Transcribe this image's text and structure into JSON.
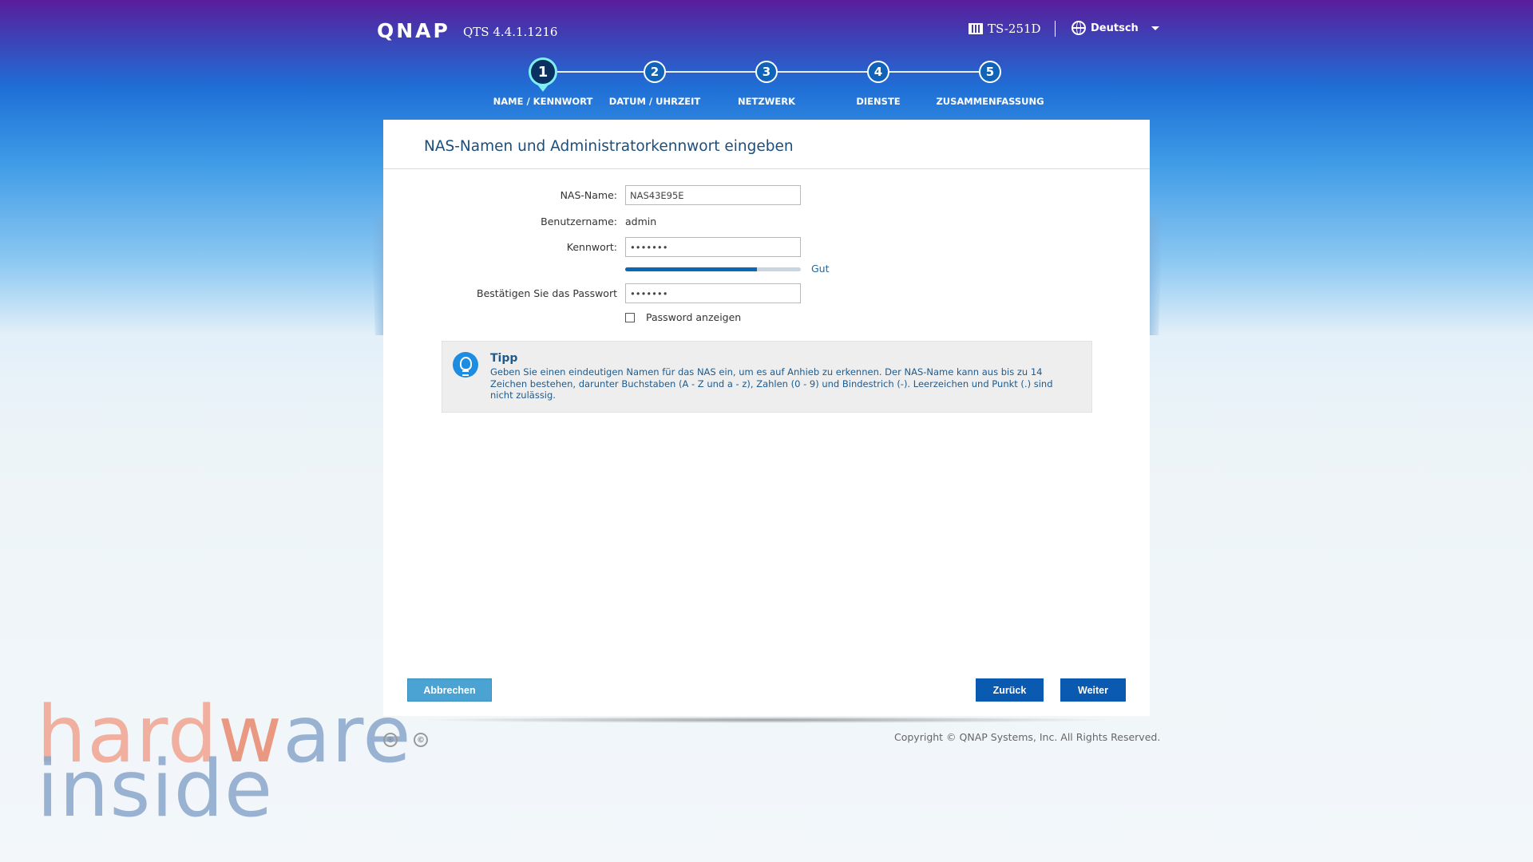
{
  "header": {
    "logo": "QNAP",
    "version": "QTS 4.4.1.1216",
    "device": "TS-251D",
    "language": "Deutsch"
  },
  "steps": [
    {
      "number": "1",
      "label": "NAME / KENNWORT",
      "active": true
    },
    {
      "number": "2",
      "label": "DATUM / UHRZEIT",
      "active": false
    },
    {
      "number": "3",
      "label": "NETZWERK",
      "active": false
    },
    {
      "number": "4",
      "label": "DIENSTE",
      "active": false
    },
    {
      "number": "5",
      "label": "ZUSAMMENFASSUNG",
      "active": false
    }
  ],
  "panel": {
    "title": "NAS-Namen und Administratorkennwort eingeben"
  },
  "form": {
    "nas_name_label": "NAS-Name:",
    "nas_name_value": "NAS43E95E",
    "username_label": "Benutzername:",
    "username_value": "admin",
    "password_label": "Kennwort:",
    "password_value": "•••••••",
    "strength_percent": 75,
    "strength_label": "Gut",
    "confirm_label": "Bestätigen Sie das Passwort",
    "confirm_value": "•••••••",
    "show_password_label": "Password anzeigen",
    "show_password_checked": false
  },
  "tip": {
    "title": "Tipp",
    "text": "Geben Sie einen eindeutigen Namen für das NAS ein, um es auf Anhieb zu erkennen. Der NAS-Name kann aus bis zu 14 Zeichen bestehen, darunter Buchstaben (A - Z und a - z), Zahlen (0 - 9) und Bindestrich (-). Leerzeichen und Punkt (.) sind nicht zulässig."
  },
  "buttons": {
    "cancel": "Abbrechen",
    "back": "Zurück",
    "next": "Weiter"
  },
  "footer": {
    "copyright": "Copyright © QNAP Systems, Inc. All Rights Reserved."
  },
  "watermark": {
    "line1_a": "hard",
    "line1_b": "w",
    "line1_c": "are",
    "line2": "inside",
    "badge1": "®",
    "badge2": "©"
  },
  "colors": {
    "primary_button": "#0a5ab2",
    "cancel_button": "#4aa3d3",
    "active_step_ring": "#7ef0f2",
    "title_text": "#1d4e7a"
  }
}
